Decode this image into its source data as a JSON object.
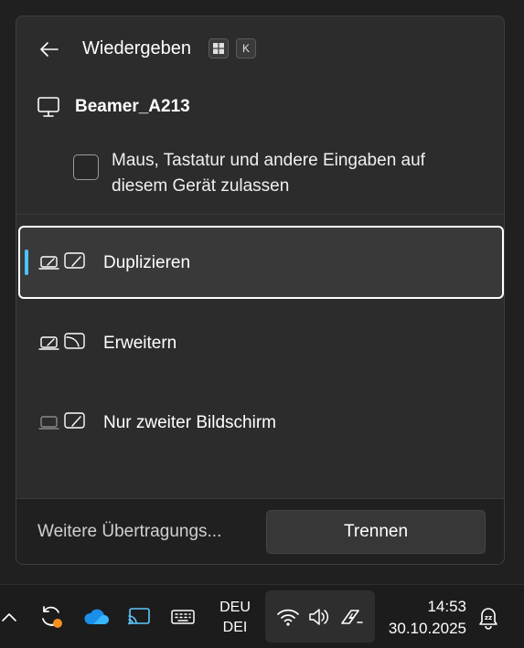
{
  "header": {
    "title": "Wiedergeben",
    "shortcut_key": "K"
  },
  "device": {
    "name": "Beamer_A213"
  },
  "input_option": {
    "label_line1": "Maus, Tastatur und andere Eingaben auf",
    "label_line2": "diesem Gerät zulassen",
    "checked": false
  },
  "projection_modes": [
    {
      "label": "Duplizieren",
      "selected": true
    },
    {
      "label": "Erweitern",
      "selected": false
    },
    {
      "label": "Nur zweiter Bildschirm",
      "selected": false
    }
  ],
  "footer": {
    "more_link": "Weitere Übertragungs...",
    "disconnect_label": "Trennen"
  },
  "taskbar": {
    "lang_line1": "DEU",
    "lang_line2": "DEI",
    "time": "14:53",
    "date": "30.10.2025",
    "notification_badge": "zz"
  },
  "colors": {
    "accent": "#4cc2ff",
    "flyout_bg": "#2c2c2c",
    "selected_bg": "#393939"
  }
}
